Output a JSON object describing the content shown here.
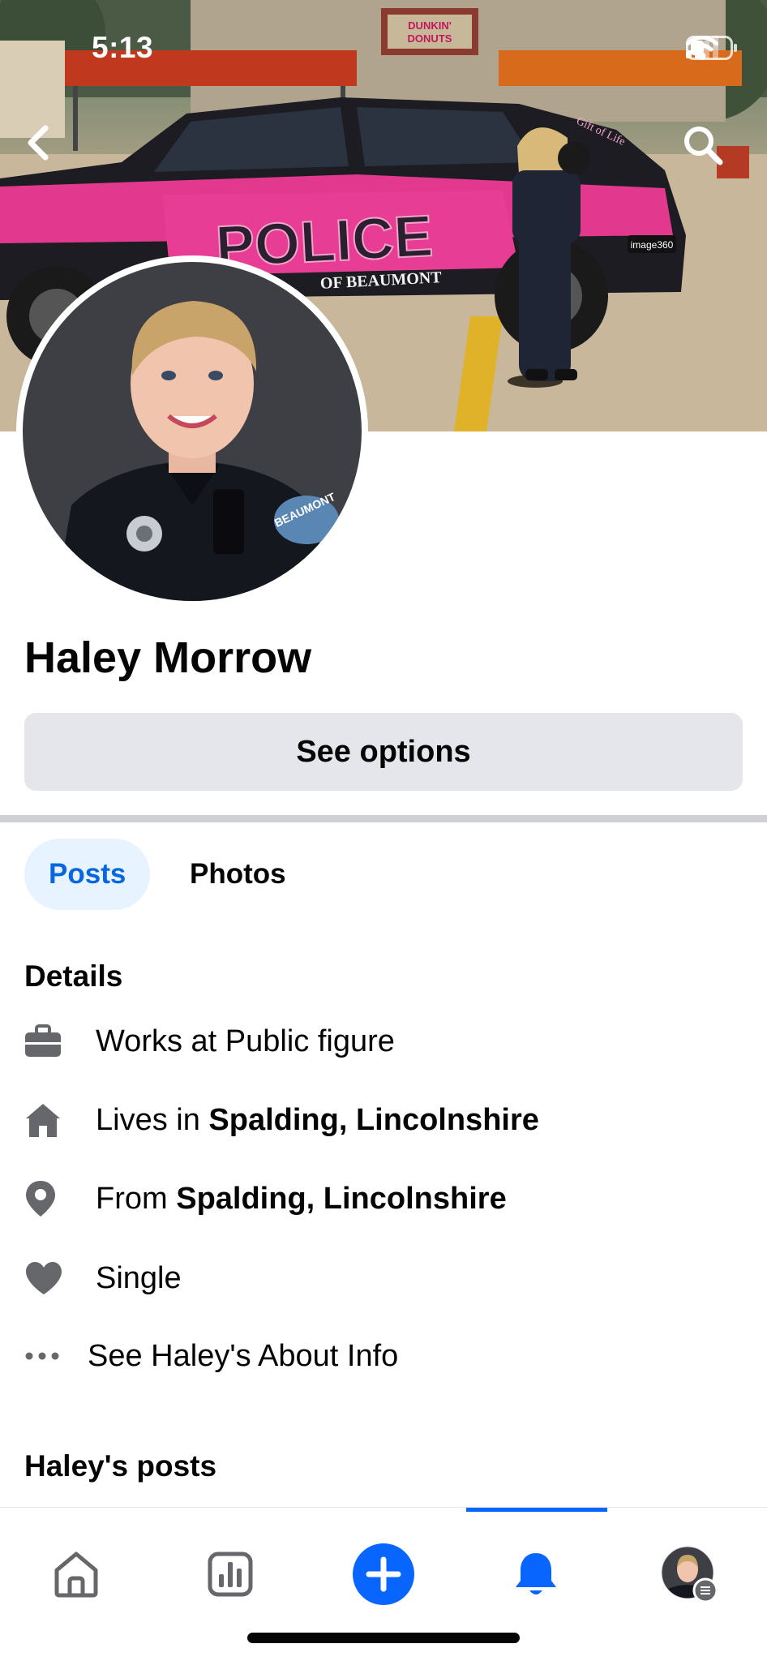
{
  "status_bar": {
    "time": "5:13"
  },
  "cover": {
    "storefront_sign": "DUNKIN' DONUTS",
    "vehicle_text": "POLICE",
    "vehicle_subtext": "OF BEAUMONT",
    "vehicle_decal": "Gift of Life",
    "vehicle_badge": "image360"
  },
  "profile": {
    "name": "Haley Morrow",
    "options_label": "See options",
    "avatar_patch": "BEAUMONT"
  },
  "tabs": [
    {
      "label": "Posts",
      "active": true
    },
    {
      "label": "Photos",
      "active": false
    }
  ],
  "details": {
    "heading": "Details",
    "work": {
      "text": "Works at Public figure",
      "icon": "briefcase-icon"
    },
    "lives": {
      "prefix": "Lives in ",
      "place": "Spalding, Lincolnshire",
      "icon": "home-icon"
    },
    "from": {
      "prefix": "From ",
      "place": "Spalding, Lincolnshire",
      "icon": "location-pin-icon"
    },
    "relationship": {
      "text": "Single",
      "icon": "heart-icon"
    },
    "about": {
      "text": "See Haley's About Info",
      "icon": "more-dots-icon"
    }
  },
  "posts_heading": "Haley's posts",
  "bottom_nav": [
    {
      "name": "home",
      "icon": "home-outline-icon"
    },
    {
      "name": "insights",
      "icon": "bar-chart-icon"
    },
    {
      "name": "create",
      "icon": "plus-icon"
    },
    {
      "name": "notifications",
      "icon": "bell-icon",
      "active": true
    },
    {
      "name": "profile",
      "icon": "avatar-icon"
    }
  ],
  "colors": {
    "accent": "#0866ff",
    "tab_active_bg": "#e7f3ff",
    "button_bg": "#e4e6eb",
    "icon_gray": "#65676b"
  }
}
